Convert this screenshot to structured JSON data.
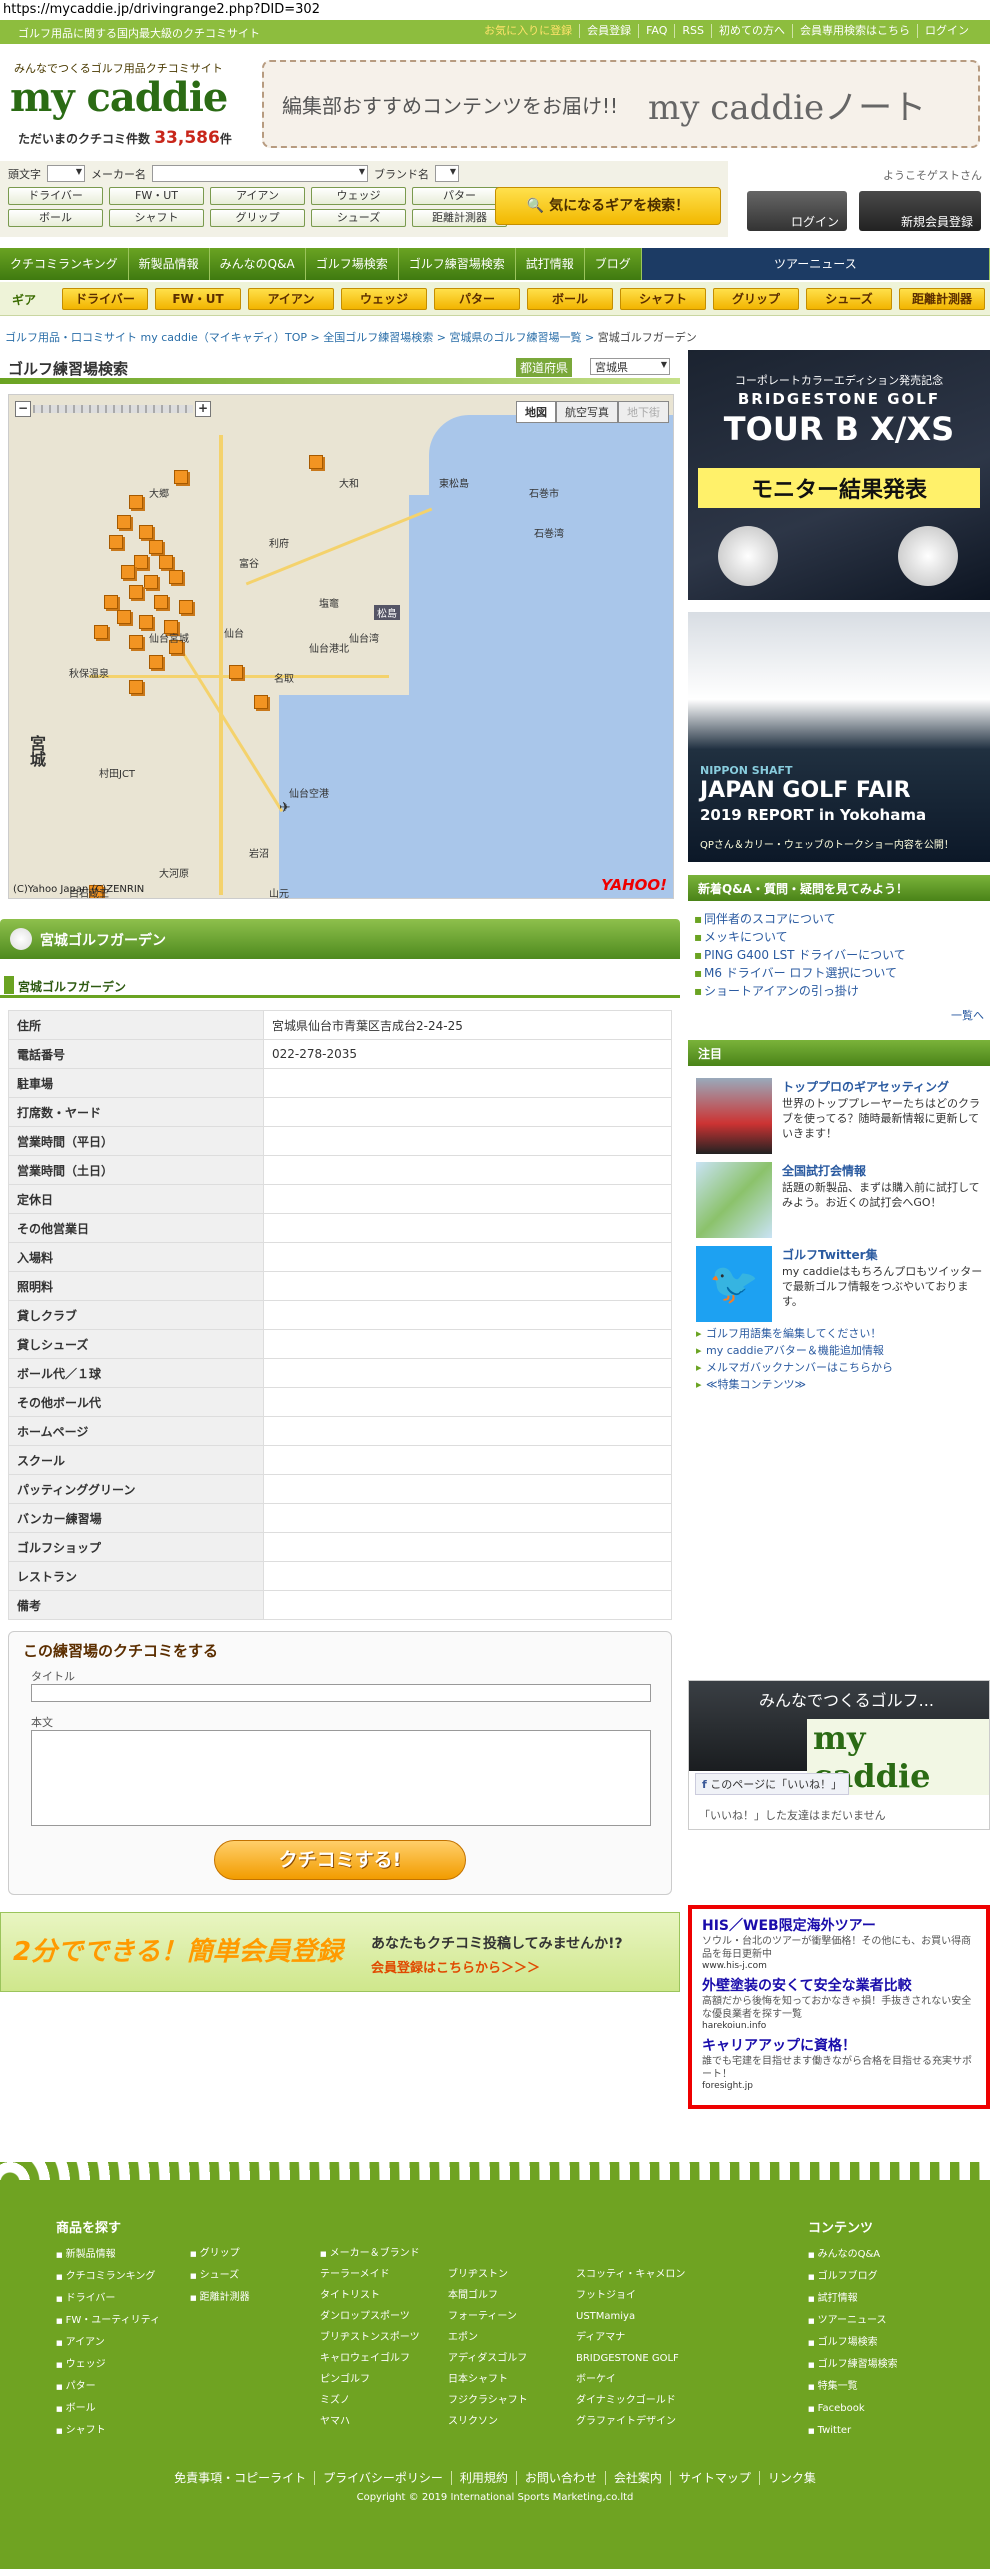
{
  "url": "https://mycaddie.jp/drivingrange2.php?DID=302",
  "topbar": {
    "tagline": "ゴルフ用品に関する国内最大級のクチコミサイト",
    "links": [
      "お気に入りに登録",
      "会員登録",
      "FAQ",
      "RSS",
      "初めての方へ",
      "会員専用検索はこちら",
      "ログイン"
    ]
  },
  "header": {
    "logo_sub": "みんなでつくるゴルフ用品クチコミサイト",
    "logo": "my caddie",
    "review_label": "ただいまのクチコミ件数",
    "review_count": "33,586",
    "review_unit": "件",
    "banner_lead": "編集部おすすめコンテンツをお届け!!",
    "banner_title": "my caddieノート"
  },
  "search": {
    "label_initial": "頭文字",
    "label_maker": "メーカー名",
    "label_brand": "ブランド名",
    "categories": [
      "ドライバー",
      "FW・UT",
      "アイアン",
      "ウェッジ",
      "パター",
      "ボール",
      "シャフト",
      "グリップ",
      "シューズ",
      "距離計測器"
    ],
    "submit": "気になるギアを検索！"
  },
  "login": {
    "guest": "ようこそゲストさん",
    "login": "ログイン",
    "register": "新規会員登録"
  },
  "gnav": [
    "クチコミランキング",
    "新製品情報",
    "みんなのQ&A",
    "ゴルフ場検索",
    "ゴルフ練習場検索",
    "試打情報",
    "ブログ",
    "ツアーニュース"
  ],
  "gearbar": {
    "label": "ギア",
    "items": [
      "ドライバー",
      "FW・UT",
      "アイアン",
      "ウェッジ",
      "パター",
      "ボール",
      "シャフト",
      "グリップ",
      "シューズ",
      "距離計測器"
    ]
  },
  "breadcrumb": {
    "items": [
      "ゴルフ用品・口コミサイト my caddie（マイキャディ）TOP",
      "全国ゴルフ練習場検索",
      "宮城県のゴルフ練習場一覧"
    ],
    "current": "宮城ゴルフガーデン"
  },
  "map": {
    "title": "ゴルフ練習場検索",
    "pref_label": "都道府県",
    "pref_value": "宮城県",
    "types": [
      "地図",
      "航空写真",
      "地下街"
    ],
    "labels": [
      "大郷",
      "大和",
      "東松島",
      "石巻市",
      "石巻湾",
      "松島",
      "塩竈",
      "富谷",
      "仙台",
      "仙台宮城",
      "秋保温泉",
      "宮城",
      "名取",
      "仙台空港",
      "仙台港北",
      "仙台湾",
      "村田JCT",
      "大河原",
      "白石蔵王",
      "岩沼",
      "山元",
      "利府"
    ],
    "copyright": "(C)Yahoo Japan,(C)ZENRIN",
    "brand": "YAHOO!"
  },
  "place": {
    "name_bar": "宮城ゴルフガーデン",
    "name_sub": "宮城ゴルフガーデン",
    "rows": [
      {
        "k": "住所",
        "v": "宮城県仙台市青葉区吉成台2-24-25"
      },
      {
        "k": "電話番号",
        "v": "022-278-2035"
      },
      {
        "k": "駐車場",
        "v": ""
      },
      {
        "k": "打席数・ヤード",
        "v": ""
      },
      {
        "k": "営業時間（平日）",
        "v": ""
      },
      {
        "k": "営業時間（土日）",
        "v": ""
      },
      {
        "k": "定休日",
        "v": ""
      },
      {
        "k": "その他営業日",
        "v": ""
      },
      {
        "k": "入場料",
        "v": ""
      },
      {
        "k": "照明料",
        "v": ""
      },
      {
        "k": "貸しクラブ",
        "v": ""
      },
      {
        "k": "貸しシューズ",
        "v": ""
      },
      {
        "k": "ボール代／１球",
        "v": ""
      },
      {
        "k": "その他ボール代",
        "v": ""
      },
      {
        "k": "ホームページ",
        "v": ""
      },
      {
        "k": "スクール",
        "v": ""
      },
      {
        "k": "パッティンググリーン",
        "v": ""
      },
      {
        "k": "バンカー練習場",
        "v": ""
      },
      {
        "k": "ゴルフショップ",
        "v": ""
      },
      {
        "k": "レストラン",
        "v": ""
      },
      {
        "k": "備考",
        "v": ""
      }
    ]
  },
  "review": {
    "heading": "この練習場のクチコミをする",
    "title_label": "タイトル",
    "body_label": "本文",
    "submit": "クチコミする!"
  },
  "reg_banner": {
    "big": "2分でできる！簡単会員登録",
    "line1": "あなたもクチコミ投稿してみませんか!?",
    "line2": "会員登録はこちらから＞＞＞"
  },
  "sidebar": {
    "ad1": {
      "line1": "コーポレートカラーエディション発売記念",
      "line2": "BRIDGESTONE GOLF",
      "line3": "TOUR B X/XS",
      "line4": "モニター結果発表"
    },
    "ad2": {
      "line1": "NIPPON SHAFT",
      "line2": "JAPAN GOLF FAIR",
      "line3": "2019 REPORT in Yokohama",
      "line4": "QPさん＆カリー・ウェッブのトークショー内容を公開！"
    },
    "qa_heading": "新着Q&A・質問・疑問を見てみよう！",
    "qa": [
      "同伴者のスコアについて",
      "メッキについて",
      "PING G400 LST ドライバーについて",
      "M6 ドライバー ロフト選択について",
      "ショートアイアンの引っ掛け"
    ],
    "qa_more": "一覧へ",
    "pick_heading": "注目",
    "picks": [
      {
        "title": "トッププロのギアセッティング",
        "desc": "世界のトッププレーヤーたちはどのクラブを使ってる？随時最新情報に更新していきます！"
      },
      {
        "title": "全国試打会情報",
        "desc": "話題の新製品、まずは購入前に試打してみよう。お近くの試打会へGO！"
      },
      {
        "title": "ゴルフTwitter集",
        "desc": "my caddieはもちろんプロもツイッターで最新ゴルフ情報をつぶやいております。"
      }
    ],
    "pick_links": [
      "ゴルフ用語集を編集してください！",
      "my caddieアバター＆機能追加情報",
      "メルマガバックナンバーはこちらから",
      "≪特集コンテンツ≫"
    ],
    "fb": {
      "name": "みんなでつくるゴルフ...",
      "logo": "my caddie",
      "like": "このページに「いいね！」",
      "friends": "「いいね！」した友達はまだいません"
    },
    "ads": [
      {
        "t": "HIS／WEB限定海外ツアー",
        "d": "ソウル・台北のツアーが衝撃価格！その他にも、お買い得商品を毎日更新中",
        "u": "www.his-j.com"
      },
      {
        "t": "外壁塗装の安くて安全な業者比較",
        "d": "高額だから後悔を知っておかなきゃ損！手抜きされない安全な優良業者を探す一覧",
        "u": "harekoiun.info"
      },
      {
        "t": "キャリアアップに資格！",
        "d": "誰でも宅建を目指せます働きながら合格を目指せる充実サポート！",
        "u": "foresight.jp"
      }
    ]
  },
  "footer": {
    "goods_heading": "商品を探す",
    "goods_col1": [
      "新製品情報",
      "クチコミランキング",
      "ドライバー",
      "FW・ユーティリティ",
      "アイアン",
      "ウェッジ",
      "パター",
      "ボール",
      "シャフト"
    ],
    "goods_col2": [
      "グリップ",
      "シューズ",
      "距離計測器"
    ],
    "maker_heading": "メーカー＆ブランド",
    "makers": [
      "テーラーメイド",
      "ブリヂストン",
      "スコッティ・キャメロン",
      "タイトリスト",
      "本間ゴルフ",
      "フットジョイ",
      "ダンロップスポーツ",
      "フォーティーン",
      "USTMamiya",
      "ブリヂストンスポーツ",
      "エポン",
      "ディアマナ",
      "キャロウェイゴルフ",
      "アディダスゴルフ",
      "BRIDGESTONE GOLF",
      "ピンゴルフ",
      "日本シャフト",
      "ボーケイ",
      "ミズノ",
      "フジクラシャフト",
      "ダイナミックゴールド",
      "ヤマハ",
      "スリクソン",
      "グラファイトデザイン"
    ],
    "contents_heading": "コンテンツ",
    "contents": [
      "みんなのQ&A",
      "ゴルフブログ",
      "試打情報",
      "ツアーニュース",
      "ゴルフ場検索",
      "ゴルフ練習場検索",
      "特集一覧",
      "Facebook",
      "Twitter"
    ],
    "links": [
      "免責事項・コピーライト",
      "プライバシーポリシー",
      "利用規約",
      "お問い合わせ",
      "会社案内",
      "サイトマップ",
      "リンク集"
    ],
    "copyright": "Copyright © 2019 International Sports Marketing,co.ltd"
  }
}
